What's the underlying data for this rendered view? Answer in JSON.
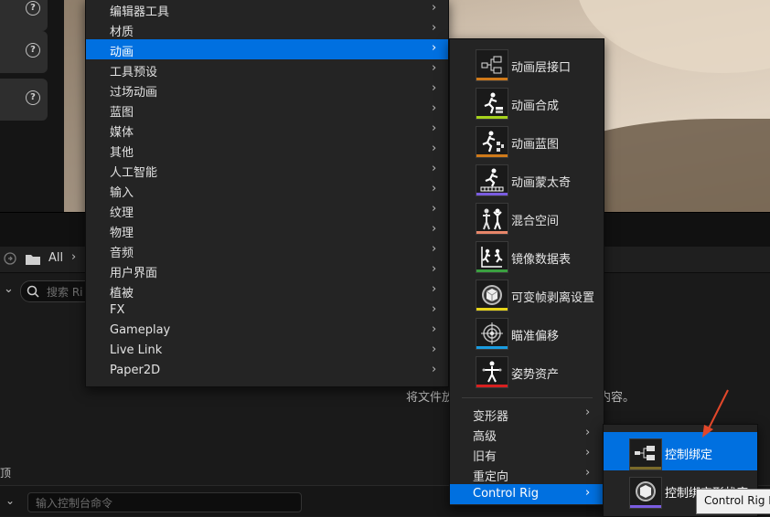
{
  "background": {
    "breadcrumb_root": "All",
    "search_placeholder": "搜索 Ri",
    "drop_hint_left": "将文件放",
    "drop_hint_right": "内容。",
    "console_placeholder": "输入控制台命令",
    "left_edge_char": "顶"
  },
  "menu_level1": {
    "items": [
      {
        "label": "编辑器工具"
      },
      {
        "label": "材质"
      },
      {
        "label": "动画",
        "selected": true
      },
      {
        "label": "工具预设"
      },
      {
        "label": "过场动画"
      },
      {
        "label": "蓝图"
      },
      {
        "label": "媒体"
      },
      {
        "label": "其他"
      },
      {
        "label": "人工智能"
      },
      {
        "label": "输入"
      },
      {
        "label": "纹理"
      },
      {
        "label": "物理"
      },
      {
        "label": "音频"
      },
      {
        "label": "用户界面"
      },
      {
        "label": "植被"
      },
      {
        "label": "FX"
      },
      {
        "label": "Gameplay"
      },
      {
        "label": "Live Link"
      },
      {
        "label": "Paper2D"
      }
    ]
  },
  "menu_animation": {
    "assets": [
      {
        "label": "动画层接口",
        "icon": "anim-layer-interface-icon",
        "color": "#d07a1a"
      },
      {
        "label": "动画合成",
        "icon": "anim-composite-icon",
        "color": "#a6d21c"
      },
      {
        "label": "动画蓝图",
        "icon": "anim-blueprint-icon",
        "color": "#d07a1a"
      },
      {
        "label": "动画蒙太奇",
        "icon": "anim-montage-icon",
        "color": "#7a5ce0"
      },
      {
        "label": "混合空间",
        "icon": "blend-space-icon",
        "color": "#e8876a"
      },
      {
        "label": "镜像数据表",
        "icon": "mirror-data-table-icon",
        "color": "#3aa040"
      },
      {
        "label": "可变帧剥离设置",
        "icon": "variable-frame-strip-icon",
        "color": "#e6d41a"
      },
      {
        "label": "瞄准偏移",
        "icon": "aim-offset-icon",
        "color": "#1a9ce0"
      },
      {
        "label": "姿势资产",
        "icon": "pose-asset-icon",
        "color": "#d82020"
      }
    ],
    "submenus": [
      {
        "label": "变形器"
      },
      {
        "label": "高级"
      },
      {
        "label": "旧有"
      },
      {
        "label": "重定向"
      },
      {
        "label": "Control Rig",
        "selected": true
      }
    ]
  },
  "menu_control_rig": {
    "items": [
      {
        "label": "控制绑定",
        "icon": "control-rig-icon",
        "color": "#7a6a2a",
        "selected": true
      },
      {
        "label": "控制绑定形状库",
        "icon": "control-rig-shape-library-icon",
        "color": "#7a5ce0"
      }
    ]
  },
  "tooltip": {
    "text": "Control Rig Bl"
  },
  "accent_color": "#0070e0"
}
